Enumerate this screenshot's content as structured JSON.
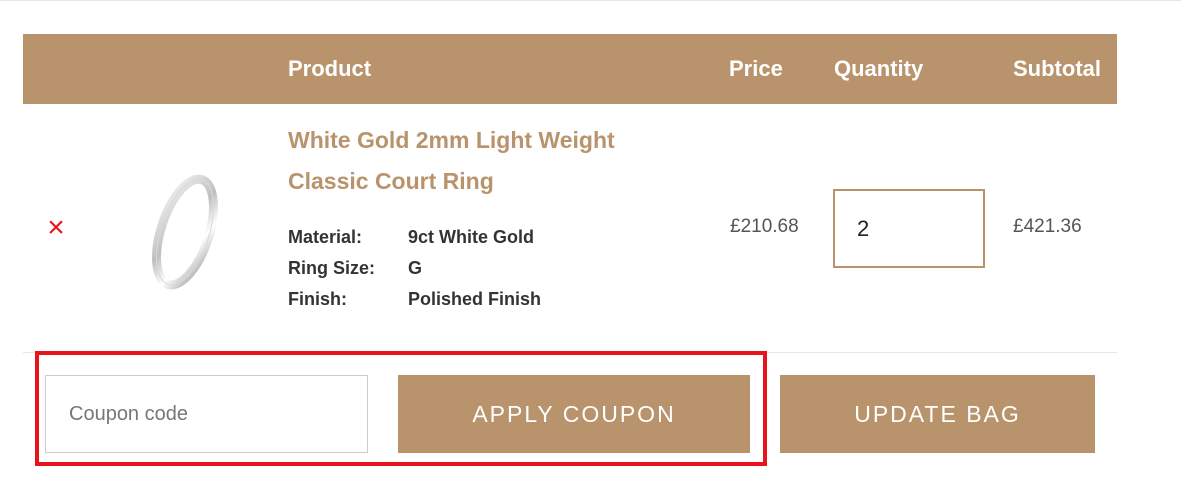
{
  "header": {
    "product": "Product",
    "price": "Price",
    "quantity": "Quantity",
    "subtotal": "Subtotal"
  },
  "item": {
    "name_line1": "White Gold 2mm Light Weight",
    "name_line2": "Classic Court Ring",
    "meta": [
      {
        "label": "Material:",
        "value": "9ct White Gold"
      },
      {
        "label": "Ring Size:",
        "value": "G"
      },
      {
        "label": "Finish:",
        "value": "Polished Finish"
      }
    ],
    "price": "£210.68",
    "quantity": "2",
    "subtotal": "£421.36",
    "remove_glyph": "×"
  },
  "coupon": {
    "placeholder": "Coupon code",
    "apply_label": "APPLY COUPON"
  },
  "update_label": "UPDATE BAG",
  "colors": {
    "accent": "#b9936c",
    "remove": "#e8141b",
    "highlight": "#e8141b"
  },
  "icons": {
    "remove": "remove-icon",
    "product_image": "ring-icon"
  }
}
